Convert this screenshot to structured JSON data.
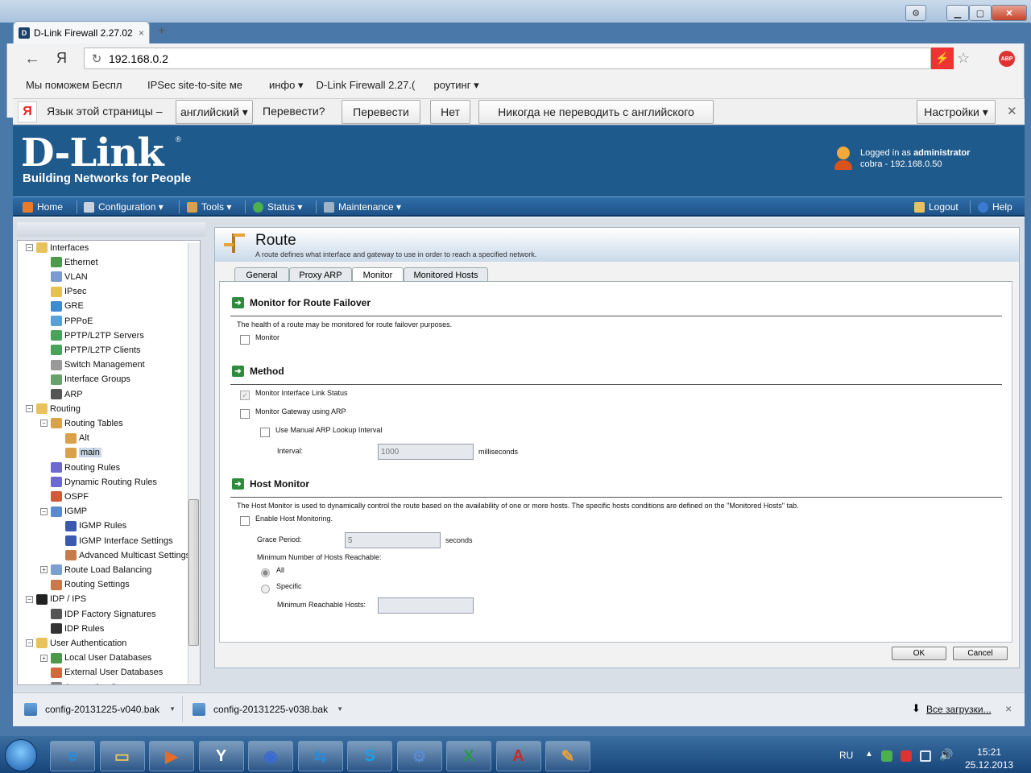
{
  "browser": {
    "tab_title": "D-Link Firewall 2.27.02",
    "new_tab": "+",
    "address": "192.168.0.2",
    "bookmarks": [
      "Мы поможем Беспл",
      "IPSec site-to-site ме",
      "инфо ▾",
      "D-Link Firewall 2.27.(",
      "роутинг ▾"
    ],
    "translate": {
      "label": "Язык этой страницы –",
      "language": "английский ▾",
      "question": "Перевести?",
      "translate_btn": "Перевести",
      "no_btn": "Нет",
      "never_btn": "Никогда не переводить с английского",
      "settings_btn": "Настройки ▾"
    }
  },
  "header": {
    "logo": "D-Link",
    "registered": "®",
    "tagline": "Building Networks for People",
    "logged_prefix": "Logged in as ",
    "user": "administrator",
    "host": "cobra - 192.168.0.50"
  },
  "menu": {
    "home": "Home",
    "configuration": "Configuration ▾",
    "tools": "Tools ▾",
    "status": "Status ▾",
    "maintenance": "Maintenance ▾",
    "logout": "Logout",
    "help": "Help"
  },
  "tree": [
    {
      "label": "Interfaces",
      "level": 0,
      "toggle": "−",
      "color": "#e8c25c"
    },
    {
      "label": "Ethernet",
      "level": 1,
      "color": "#4c9a4c"
    },
    {
      "label": "VLAN",
      "level": 1,
      "color": "#7a9ad0"
    },
    {
      "label": "IPsec",
      "level": 1,
      "color": "#e6c24a"
    },
    {
      "label": "GRE",
      "level": 1,
      "color": "#3f8bd0"
    },
    {
      "label": "PPPoE",
      "level": 1,
      "color": "#57a0d8"
    },
    {
      "label": "PPTP/L2TP Servers",
      "level": 1,
      "color": "#4aa25a"
    },
    {
      "label": "PPTP/L2TP Clients",
      "level": 1,
      "color": "#4aa25a"
    },
    {
      "label": "Switch Management",
      "level": 1,
      "color": "#999999"
    },
    {
      "label": "Interface Groups",
      "level": 1,
      "color": "#6aa06a"
    },
    {
      "label": "ARP",
      "level": 1,
      "color": "#555555"
    },
    {
      "label": "Routing",
      "level": 0,
      "toggle": "−",
      "color": "#e8c25c"
    },
    {
      "label": "Routing Tables",
      "level": 1,
      "toggle": "−",
      "color": "#d9a24a"
    },
    {
      "label": "Alt",
      "level": 2,
      "color": "#d9a24a"
    },
    {
      "label": "main",
      "level": 2,
      "color": "#d9a24a",
      "selected": true
    },
    {
      "label": "Routing Rules",
      "level": 1,
      "color": "#6a6ad0"
    },
    {
      "label": "Dynamic Routing Rules",
      "level": 1,
      "color": "#6a6ad0"
    },
    {
      "label": "OSPF",
      "level": 1,
      "color": "#d05a3a"
    },
    {
      "label": "IGMP",
      "level": 1,
      "toggle": "−",
      "color": "#5a8ad0"
    },
    {
      "label": "IGMP Rules",
      "level": 2,
      "color": "#3a5ab0"
    },
    {
      "label": "IGMP Interface Settings",
      "level": 2,
      "color": "#3a5ab0"
    },
    {
      "label": "Advanced Multicast Settings",
      "level": 2,
      "color": "#c97a4a"
    },
    {
      "label": "Route Load Balancing",
      "level": 1,
      "toggle": "+",
      "color": "#7aa0d0"
    },
    {
      "label": "Routing Settings",
      "level": 1,
      "color": "#c97a4a"
    },
    {
      "label": "IDP / IPS",
      "level": 0,
      "toggle": "−",
      "color": "#222222"
    },
    {
      "label": "IDP Factory Signatures",
      "level": 1,
      "color": "#555555"
    },
    {
      "label": "IDP Rules",
      "level": 1,
      "color": "#333333"
    },
    {
      "label": "User Authentication",
      "level": 0,
      "toggle": "−",
      "color": "#e8c25c"
    },
    {
      "label": "Local User Databases",
      "level": 1,
      "toggle": "+",
      "color": "#4a9a4a"
    },
    {
      "label": "External User Databases",
      "level": 1,
      "color": "#d06a3a"
    },
    {
      "label": "Accounting Servers",
      "level": 1,
      "color": "#888888"
    }
  ],
  "route": {
    "title": "Route",
    "description": "A route defines what interface and gateway to use in order to reach a specified network.",
    "tabs": [
      "General",
      "Proxy ARP",
      "Monitor",
      "Monitored Hosts"
    ],
    "active_tab": "Monitor",
    "monitor_section": {
      "title": "Monitor for Route Failover",
      "desc": "The health of a route may be monitored for route failover purposes.",
      "monitor_label": "Monitor"
    },
    "method_section": {
      "title": "Method",
      "link_status": "Monitor Interface Link Status",
      "gateway_arp": "Monitor Gateway using ARP",
      "manual_arp": "Use Manual ARP Lookup Interval",
      "interval_label": "Interval:",
      "interval_value": "1000",
      "interval_unit": "milliseconds"
    },
    "host_section": {
      "title": "Host Monitor",
      "desc": "The Host Monitor is used to dynamically control the route based on the availability of one or more hosts. The specific hosts conditions are defined on the \"Monitored Hosts\" tab.",
      "enable_label": "Enable Host Monitoring.",
      "grace_label": "Grace Period:",
      "grace_value": "5",
      "grace_unit": "seconds",
      "min_hosts_label": "Minimum Number of Hosts Reachable:",
      "all_label": "All",
      "specific_label": "Specific",
      "min_reachable_label": "Minimum Reachable Hosts:"
    },
    "ok": "OK",
    "cancel": "Cancel"
  },
  "downloads": {
    "file1": "config-20131225-v040.bak",
    "file2": "config-20131225-v038.bak",
    "all": "Все загрузки...",
    "close": "×"
  },
  "taskbar": {
    "lang": "RU",
    "time": "15:21",
    "date": "25.12.2013",
    "icons": [
      "e",
      "▭",
      "▶",
      "Y",
      "◉",
      "⇆",
      "S",
      "⚙",
      "X",
      "A",
      "✎"
    ]
  }
}
